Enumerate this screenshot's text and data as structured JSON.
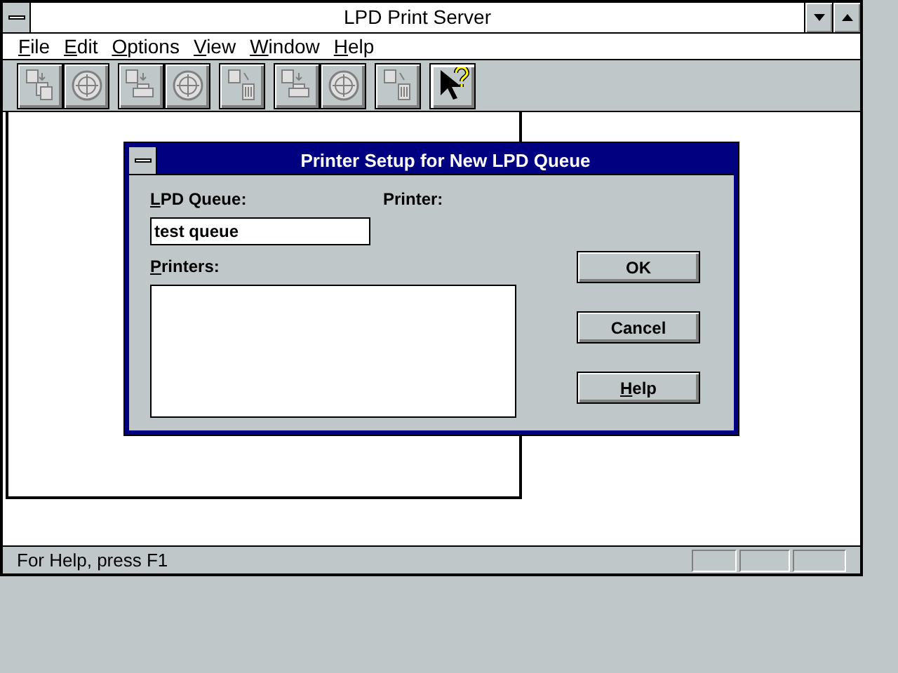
{
  "window": {
    "title": "LPD Print Server"
  },
  "menu": [
    {
      "label": "File",
      "underline_first": true
    },
    {
      "label": "Edit",
      "underline_first": true
    },
    {
      "label": "Options",
      "underline_first": true
    },
    {
      "label": "View",
      "underline_first": true
    },
    {
      "label": "Window",
      "underline_first": true
    },
    {
      "label": "Help",
      "underline_first": true
    }
  ],
  "toolbar": [
    [
      {
        "kind": "pages",
        "disabled": true
      },
      {
        "kind": "disc",
        "disabled": true
      }
    ],
    [
      {
        "kind": "printer",
        "disabled": true
      },
      {
        "kind": "disc",
        "disabled": true
      }
    ],
    [
      {
        "kind": "bin",
        "disabled": true
      }
    ],
    [
      {
        "kind": "printer",
        "disabled": true
      },
      {
        "kind": "disc",
        "disabled": true
      }
    ],
    [
      {
        "kind": "bin",
        "disabled": true
      }
    ],
    [
      {
        "kind": "help",
        "disabled": false
      }
    ]
  ],
  "dialog": {
    "title": "Printer Setup for New LPD Queue",
    "queue_label": {
      "label": "LPD Queue:",
      "underline_first": true
    },
    "queue_value": "test queue",
    "printer_label": "Printer:",
    "printers_label": {
      "label": "Printers:",
      "underline_first": true
    },
    "buttons": [
      {
        "label": "OK",
        "underline_first": false
      },
      {
        "label": "Cancel",
        "underline_first": false
      },
      {
        "label": "Help",
        "underline_first": true
      }
    ]
  },
  "status_bar": {
    "text": "For Help, press F1"
  }
}
